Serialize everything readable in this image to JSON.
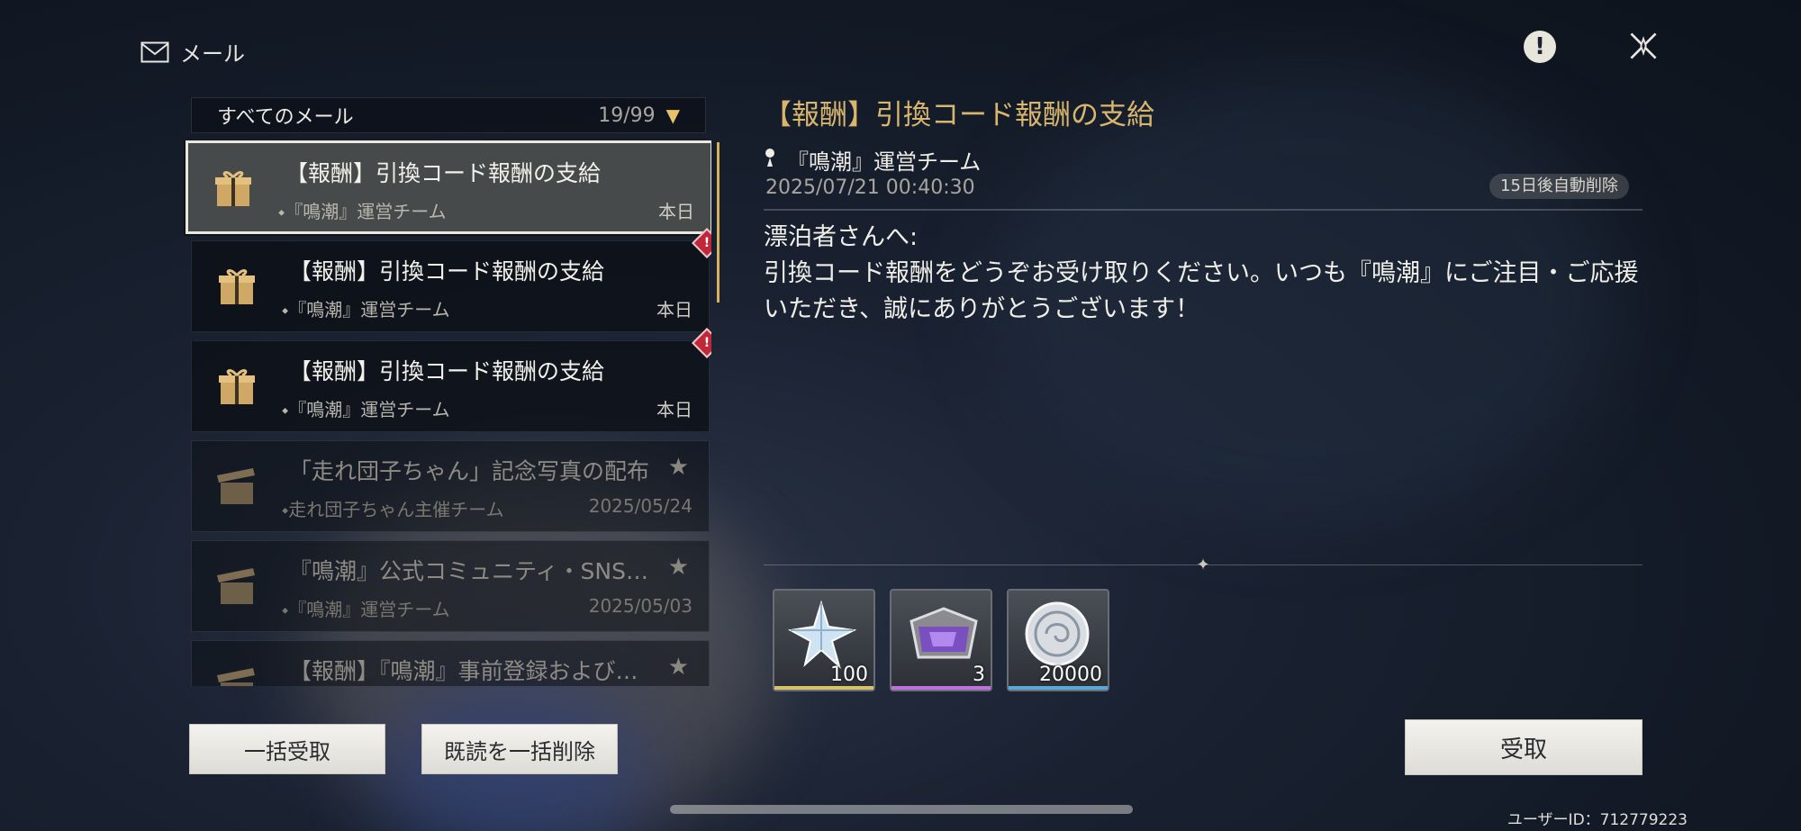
{
  "header": {
    "title": "メール",
    "icons": [
      "mail-icon",
      "alert-icon",
      "close-icon"
    ]
  },
  "list": {
    "filter_label": "すべてのメール",
    "count": "19/99",
    "items": [
      {
        "subject": "【報酬】引換コード報酬の支給",
        "sender": "『鳴潮』運営チーム",
        "date": "本日",
        "state": "selected"
      },
      {
        "subject": "【報酬】引換コード報酬の支給",
        "sender": "『鳴潮』運営チーム",
        "date": "本日",
        "state": "new"
      },
      {
        "subject": "【報酬】引換コード報酬の支給",
        "sender": "『鳴潮』運営チーム",
        "date": "本日",
        "state": "new"
      },
      {
        "subject": "「走れ団子ちゃん」記念写真の配布",
        "sender": "走れ団子ちゃん主催チーム",
        "date": "2025/05/24",
        "state": "read-starred"
      },
      {
        "subject": "『鳴潮』公式コミュニティ・SNS…",
        "sender": "『鳴潮』運営チーム",
        "date": "2025/05/03",
        "state": "read-starred"
      },
      {
        "subject": "【報酬】『鳴潮』事前登録および…",
        "sender": "",
        "date": "",
        "state": "read-starred"
      }
    ]
  },
  "detail": {
    "title": "【報酬】引換コード報酬の支給",
    "sender": "『鳴潮』運営チーム",
    "datetime": "2025/07/21 00:40:30",
    "auto_delete": "15日後自動削除",
    "body_line1": "漂泊者さんへ:",
    "body_line2": "引換コード報酬をどうぞお受け取りください。いつも『鳴潮』にご注目・ご応援いただき、誠にありがとうございます！",
    "rewards": [
      {
        "icon": "crystal-star-icon",
        "quantity": "100",
        "rarity_color": "#d9c36a"
      },
      {
        "icon": "purple-chest-icon",
        "quantity": "3",
        "rarity_color": "#c070e0"
      },
      {
        "icon": "silver-coin-icon",
        "quantity": "20000",
        "rarity_color": "#5aa8d8"
      }
    ]
  },
  "buttons": {
    "claim_all": "一括受取",
    "delete_read": "既読を一括削除",
    "claim": "受取"
  },
  "footer": {
    "user_id": "ユーザーID：712779223"
  }
}
